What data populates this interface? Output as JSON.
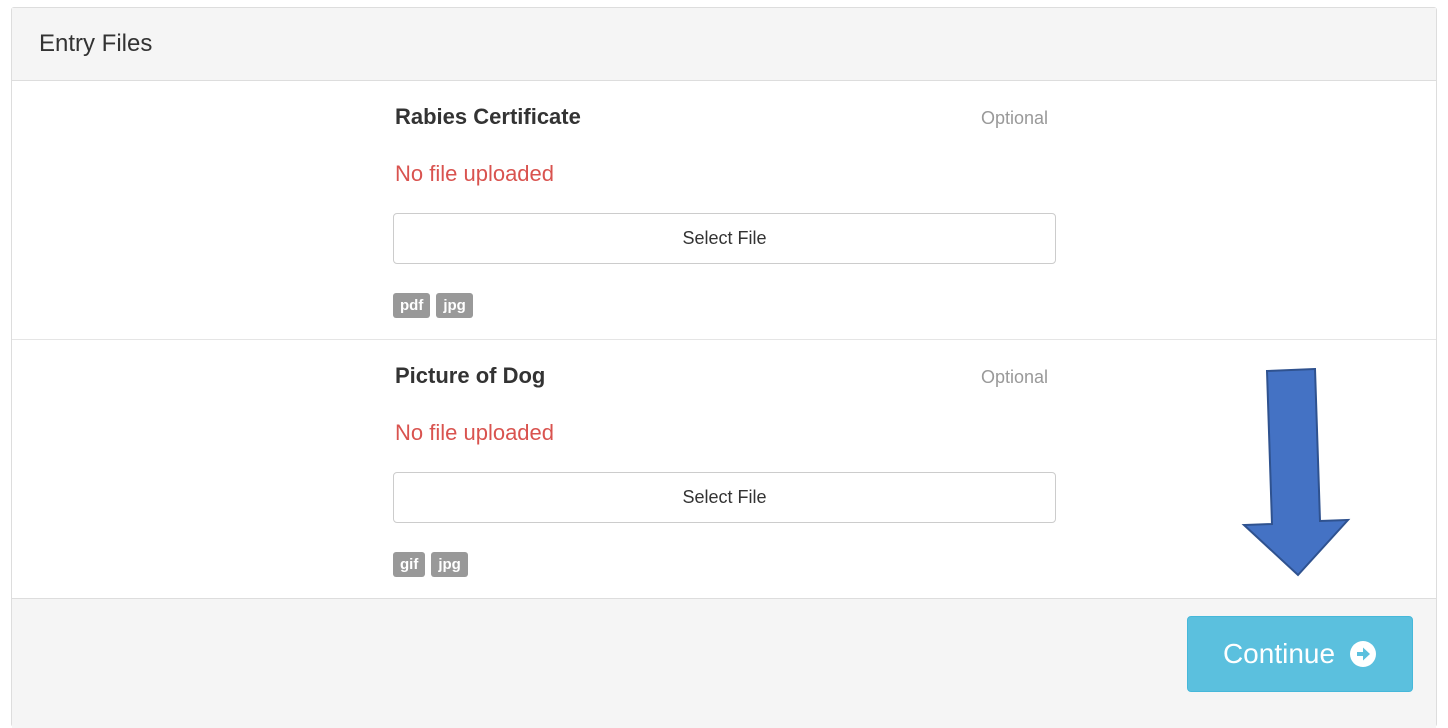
{
  "panel": {
    "title": "Entry Files"
  },
  "files": [
    {
      "name": "Rabies Certificate",
      "optional_label": "Optional",
      "status": "No file uploaded",
      "select_label": "Select File",
      "extensions": [
        "pdf",
        "jpg"
      ]
    },
    {
      "name": "Picture of Dog",
      "optional_label": "Optional",
      "status": "No file uploaded",
      "select_label": "Select File",
      "extensions": [
        "gif",
        "jpg"
      ]
    }
  ],
  "footer": {
    "continue_label": "Continue",
    "continue_icon": "arrow-circle-right-icon"
  },
  "colors": {
    "status_error": "#d9534f",
    "continue_bg": "#5bc0de",
    "badge_bg": "#999999",
    "annotation_arrow": "#4472c4"
  },
  "annotation": {
    "icon": "down-arrow-icon"
  }
}
